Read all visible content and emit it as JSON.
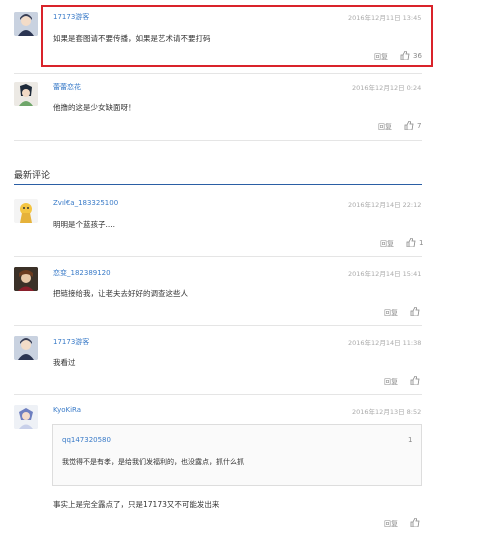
{
  "hot_comments": [
    {
      "user": "17173游客",
      "time": "2016年12月11日 13:45",
      "text": "如果是套图请不要传播，如果是艺术请不要打码",
      "reply": "回复",
      "likes": "36"
    },
    {
      "user": "蕾蕾恋花",
      "time": "2016年12月12日 0:24",
      "text": "他撸的这是少女缺面呀！",
      "reply": "回复",
      "likes": "7"
    }
  ],
  "latest_title": "最新评论",
  "latest_comments": [
    {
      "user": "Ζvıl€a_183325100",
      "time": "2016年12月14日 22:12",
      "text": "明明是个蓝孩子....",
      "reply": "回复",
      "likes": "1"
    },
    {
      "user": "恋变_182389120",
      "time": "2016年12月14日 15:41",
      "text": "把链接给我，让老夫去好好的调查这些人",
      "reply": "回复",
      "likes": ""
    },
    {
      "user": "17173游客",
      "time": "2016年12月14日 11:38",
      "text": "我看过",
      "reply": "回复",
      "likes": ""
    },
    {
      "user": "KyoKiRa",
      "time": "2016年12月13日 8:52",
      "text": "事实上是完全露点了，只是17173又不可能发出来",
      "reply": "回复",
      "likes": "",
      "quote": {
        "user": "qq147320580",
        "num": "1",
        "text": "我觉得不是有孝，是给我们发福利的，也没露点，抓什么抓"
      }
    }
  ]
}
